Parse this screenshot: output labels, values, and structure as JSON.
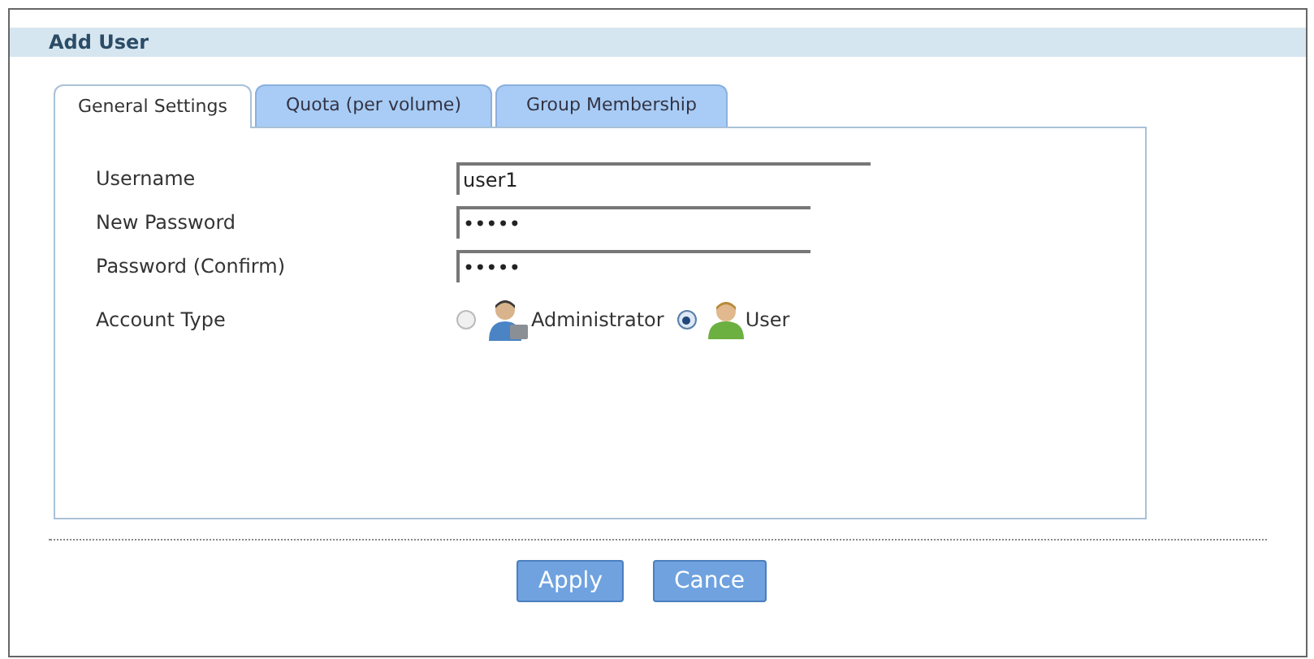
{
  "window": {
    "title": "Add User"
  },
  "tabs": [
    {
      "label": "General Settings",
      "selected": true
    },
    {
      "label": "Quota (per volume)",
      "selected": false
    },
    {
      "label": "Group Membership",
      "selected": false
    }
  ],
  "fields": [
    {
      "label": "Username",
      "value": "user1",
      "kind": "wide"
    },
    {
      "label": "New Password",
      "value": "•••••",
      "kind": "narrow"
    },
    {
      "label": "Password (Confirm)",
      "value": "•••••",
      "kind": "narrow"
    }
  ],
  "account_type": {
    "label": "Account Type",
    "options": [
      {
        "label": "Administrator",
        "kind": "admin",
        "selected": false
      },
      {
        "label": "User",
        "kind": "user",
        "selected": true
      }
    ]
  },
  "buttons": [
    "Apply",
    "Cance"
  ]
}
